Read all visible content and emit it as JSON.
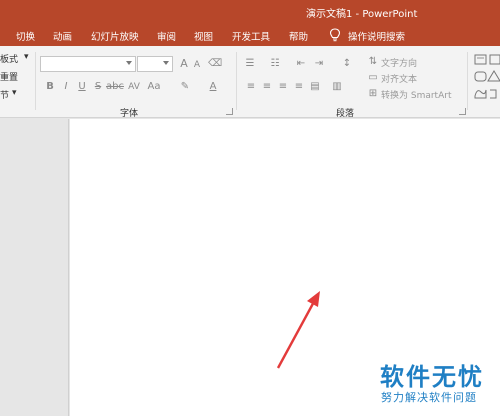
{
  "window": {
    "title": "演示文稿1 - PowerPoint"
  },
  "tabs": [
    "切换",
    "动画",
    "幻灯片放映",
    "审阅",
    "视图",
    "开发工具",
    "帮助",
    "操作说明搜索"
  ],
  "left_truncated": [
    "板式",
    "重置",
    "节"
  ],
  "font_group": {
    "label": "字体",
    "font_name_value": "",
    "font_size_value": "",
    "bold": "B",
    "italic": "I",
    "underline": "U",
    "strike": "S",
    "shadow": "abc",
    "spacing": "AV",
    "case": "Aa",
    "grow": "A",
    "shrink": "A"
  },
  "paragraph_group": {
    "label": "段落",
    "text_direction": "文字方向",
    "align_text": "对齐文本",
    "convert_smartart": "转换为 SmartArt"
  },
  "watermark": {
    "title": "软件无忧",
    "subtitle": "努力解决软件问题"
  },
  "colors": {
    "accent": "#b7472a",
    "ribbon": "#f3f3f3",
    "watermark": "#1f7fc4",
    "arrow": "#e33b3b"
  }
}
